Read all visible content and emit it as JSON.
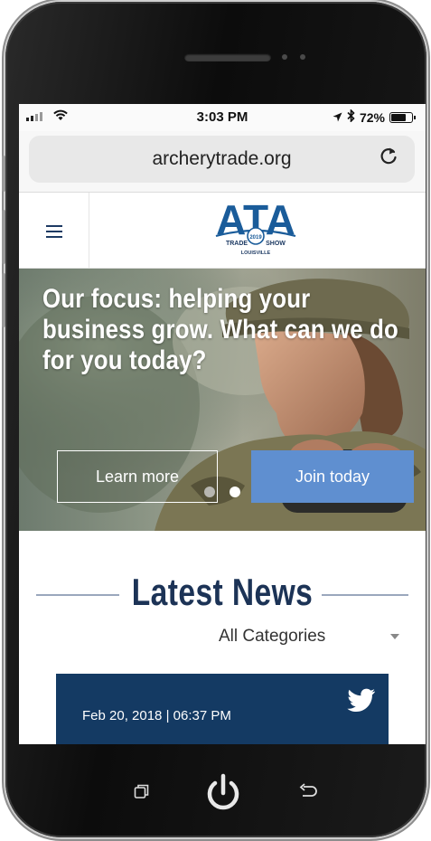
{
  "status_bar": {
    "time": "3:03 PM",
    "battery": "72%",
    "battery_level": 0.72,
    "icons": [
      "signal-icon",
      "wifi-icon",
      "location-icon",
      "bluetooth-icon",
      "battery-icon"
    ]
  },
  "browser": {
    "url": "archerytrade.org",
    "reload_icon": "reload-icon"
  },
  "site": {
    "logo": {
      "letters": "ATA",
      "year": "2019",
      "line1_left": "TRADE",
      "line1_right": "SHOW",
      "city": "LOUISVILLE"
    },
    "menu_icon": "hamburger-menu-icon"
  },
  "hero": {
    "heading": "Our focus: helping your business grow. What can we do for you today?",
    "learn_more": "Learn more",
    "join_today": "Join today",
    "slides": 2,
    "active_slide": 2
  },
  "news": {
    "title": "Latest News",
    "category_selected": "All Categories",
    "tweet": {
      "date": "Feb 20, 2018 | 06:37 PM",
      "icon": "twitter-bird-icon"
    }
  },
  "device_controls": [
    "recent-apps-icon",
    "power-icon",
    "back-icon"
  ],
  "colors": {
    "navy": "#143a63",
    "join_blue": "#5f8fd0",
    "title_navy": "#1c3356"
  }
}
